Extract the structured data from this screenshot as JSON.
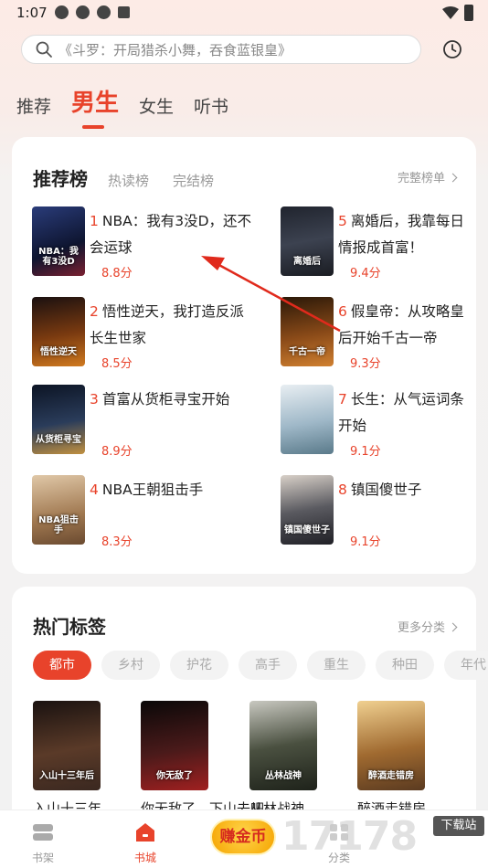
{
  "status": {
    "time": "1:07"
  },
  "search": {
    "placeholder": "《斗罗：开局猎杀小舞，吞食蓝银皇》"
  },
  "tabs": [
    {
      "label": "推荐"
    },
    {
      "label": "男生"
    },
    {
      "label": "女生"
    },
    {
      "label": "听书"
    }
  ],
  "ranking": {
    "title": "推荐榜",
    "tab1": "热读榜",
    "tab2": "完结榜",
    "more": "完整榜单",
    "books": [
      {
        "num": "1",
        "title": "NBA：我有3没D，还不会运球",
        "score": "8.8分",
        "cover": "#1c2a5a"
      },
      {
        "num": "2",
        "title": "悟性逆天，我打造反派长生世家",
        "score": "8.5分",
        "cover": "#5a2a10"
      },
      {
        "num": "3",
        "title": "首富从货柜寻宝开始",
        "score": "8.9分",
        "cover": "#1a2638"
      },
      {
        "num": "4",
        "title": "NBA王朝狙击手",
        "score": "8.3分",
        "cover": "#b79a77"
      },
      {
        "num": "5",
        "title": "离婚后，我靠每日情报成首富！",
        "score": "9.4分",
        "cover": "#2c2f3a"
      },
      {
        "num": "6",
        "title": "假皇帝：从攻略皇后开始千古一帝",
        "score": "9.3分",
        "cover": "#4a2a14"
      },
      {
        "num": "7",
        "title": "长生：从气运词条开始",
        "score": "9.1分",
        "cover": "#9fb8c8"
      },
      {
        "num": "8",
        "title": "镇国傻世子",
        "score": "9.1分",
        "cover": "#3a3a40"
      }
    ],
    "cover_texts": [
      "NBA：我有3没D",
      "悟性逆天",
      "从货柜寻宝",
      "NBA狙击手",
      "离婚后",
      "千古一帝",
      "",
      "镇国傻世子"
    ]
  },
  "tags_section": {
    "title": "热门标签",
    "more": "更多分类",
    "tags": [
      "都市",
      "乡村",
      "护花",
      "高手",
      "重生",
      "种田",
      "年代"
    ],
    "books": [
      {
        "title": "入山十三年",
        "cover": "#3a2820",
        "cover_text": "入山十三年后"
      },
      {
        "title": "你无敌了，下山去吧",
        "cover": "#2a1a1a",
        "cover_text": "你无敌了"
      },
      {
        "title": "从林战神",
        "cover": "#2e3328",
        "cover_text": "丛林战神"
      },
      {
        "title": "醉酒走错房",
        "cover": "#5a3a20",
        "cover_text": "醉酒走错房"
      }
    ]
  },
  "nav": {
    "shelf": "书架",
    "store": "书城",
    "earn": "赚金币",
    "category": "分类"
  },
  "watermark": {
    "text": "17178",
    "badge": "下载站"
  }
}
